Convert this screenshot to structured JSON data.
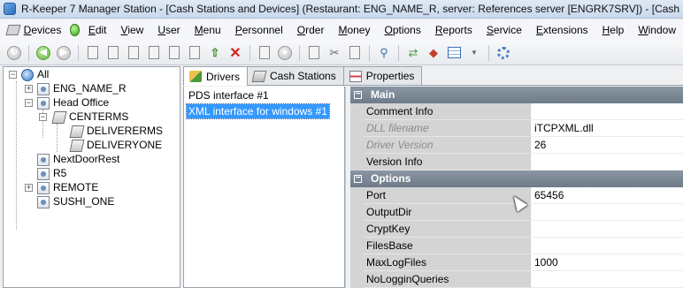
{
  "window": {
    "title": "R-Keeper 7 Manager Station - [Cash Stations and Devices] (Restaurant: ENG_NAME_R, server: References server [ENGRK7SRV]) - [Cash Stations"
  },
  "menu": {
    "items": [
      "Devices",
      "Edit",
      "View",
      "User",
      "Menu",
      "Personnel",
      "Order",
      "Money",
      "Options",
      "Reports",
      "Service",
      "Extensions",
      "Help",
      "Window"
    ]
  },
  "tree": {
    "nodes": [
      {
        "label": "All",
        "icon": "globe-icon"
      },
      {
        "label": "ENG_NAME_R",
        "icon": "restaurant-icon"
      },
      {
        "label": "Head Office",
        "icon": "restaurant-icon"
      },
      {
        "label": "CENTERMS",
        "icon": "cash-server-icon"
      },
      {
        "label": "DELIVERERMS",
        "icon": "cash-terminal-icon"
      },
      {
        "label": "DELIVERYONE",
        "icon": "cash-terminal-icon"
      },
      {
        "label": "NextDoorRest",
        "icon": "restaurant-icon"
      },
      {
        "label": "R5",
        "icon": "restaurant-icon"
      },
      {
        "label": "REMOTE",
        "icon": "restaurant-icon"
      },
      {
        "label": "SUSHI_ONE",
        "icon": "restaurant-icon"
      }
    ]
  },
  "tabs": [
    {
      "label": "Drivers",
      "icon": "drivers-icon",
      "active": true
    },
    {
      "label": "Cash Stations",
      "icon": "cash-station-icon",
      "active": false
    },
    {
      "label": "Properties",
      "icon": "properties-icon",
      "active": false
    }
  ],
  "drivers": {
    "items": [
      {
        "label": "PDS interface #1",
        "selected": false
      },
      {
        "label": "XML interface for windows #1",
        "selected": true
      }
    ]
  },
  "properties": {
    "main_title": "Main",
    "options_title": "Options",
    "main": [
      {
        "name": "Comment Info",
        "value": "",
        "readonly": false
      },
      {
        "name": "DLL filename",
        "value": "iTCPXML.dll",
        "readonly": true
      },
      {
        "name": "Driver Version",
        "value": "26",
        "readonly": true
      },
      {
        "name": "Version Info",
        "value": "",
        "readonly": false
      }
    ],
    "options": [
      {
        "name": "Port",
        "value": "65456"
      },
      {
        "name": "OutputDir",
        "value": ""
      },
      {
        "name": "CryptKey",
        "value": ""
      },
      {
        "name": "FilesBase",
        "value": ""
      },
      {
        "name": "MaxLogFiles",
        "value": "1000"
      },
      {
        "name": "NoLogginQueries",
        "value": ""
      }
    ]
  }
}
